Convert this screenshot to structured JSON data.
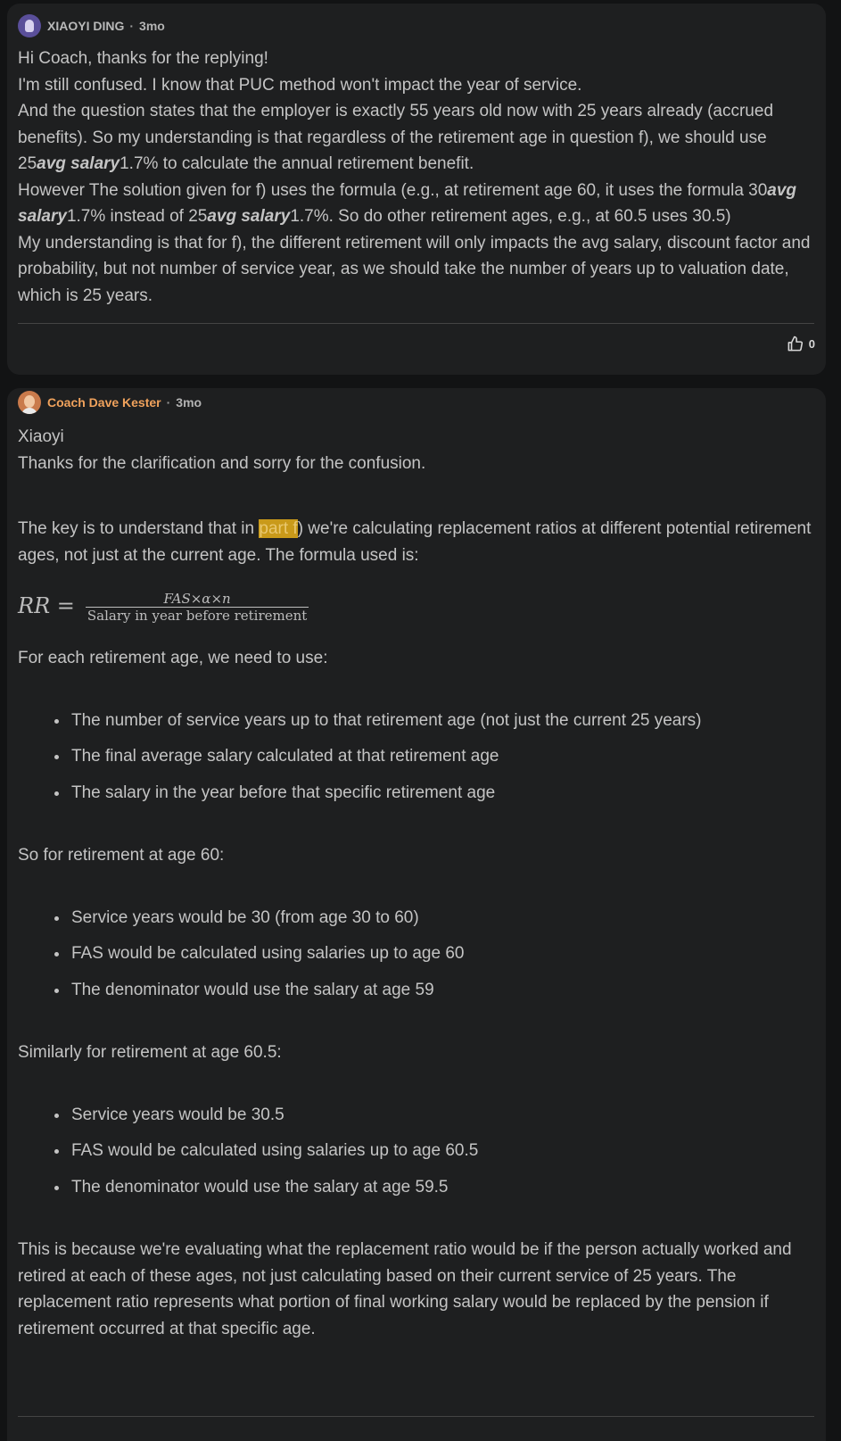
{
  "comment1": {
    "author": "XIAOYI DING",
    "separator": "·",
    "time": "3mo",
    "lines": [
      "Hi Coach, thanks for the replying!",
      "I'm still confused. I know that PUC method won't impact the year of service."
    ],
    "p3": "And the question states that the employer is exactly 55 years old now with 25 years already (accrued benefits). So my understanding is that regardless of the retirement age in question f), we should use 25",
    "p3_em": "avg salary",
    "p3_end": "1.7% to calculate the annual retirement benefit.",
    "p4_a": "However The solution given for f) uses the formula (e.g., at retirement age 60, it uses the formula 30",
    "p4_em1": "avg salary",
    "p4_b": "1.7% instead of 25",
    "p4_em2": "avg salary",
    "p4_c": "1.7%. So do other retirement ages, e.g., at 60.5 uses 30.5)",
    "p5": "My understanding is that for f), the different retirement will only impacts the avg salary, discount factor and probability, but not number of service year, as we should take the number of years up to valuation date, which is 25 years.",
    "like_count": "0"
  },
  "comment2": {
    "author": "Coach Dave Kester",
    "separator": "·",
    "time": "3mo",
    "greeting": "Xiaoyi",
    "thanks": "Thanks for the clarification and sorry for the confusion.",
    "key_a": "The key is to understand that in ",
    "key_hl": "part f",
    "key_b": ") we're calculating replacement ratios at different potential retirement ages, not just at the current age. The formula used is:",
    "formula": {
      "lhs": "RR =",
      "numerator": "FAS×α×n",
      "denominator": "Salary in year before retirement"
    },
    "each_age_intro": "For each retirement age, we need to use:",
    "each_age_items": [
      "The number of service years up to that retirement age (not just the current 25 years)",
      "The final average salary calculated at that retirement age",
      "The salary in the year before that specific retirement age"
    ],
    "age60_intro": "So for retirement at age 60:",
    "age60_items": [
      "Service years would be 30 (from age 30 to 60)",
      "FAS would be calculated using salaries up to age 60",
      "The denominator would use the salary at age 59"
    ],
    "age605_intro": "Similarly for retirement at age 60.5:",
    "age605_items": [
      "Service years would be 30.5",
      "FAS would be calculated using salaries up to age 60.5",
      "The denominator would use the salary at age 59.5"
    ],
    "closing": "This is because we're evaluating what the replacement ratio would be if the person actually worked and retired at each of these ages, not just calculating based on their current service of 25 years. The replacement ratio represents what portion of final working salary would be replaced by the pension if retirement occurred at that specific age."
  },
  "icons": [
    "avatar-xiaoyi",
    "avatar-coach",
    "thumbs-up-icon"
  ]
}
